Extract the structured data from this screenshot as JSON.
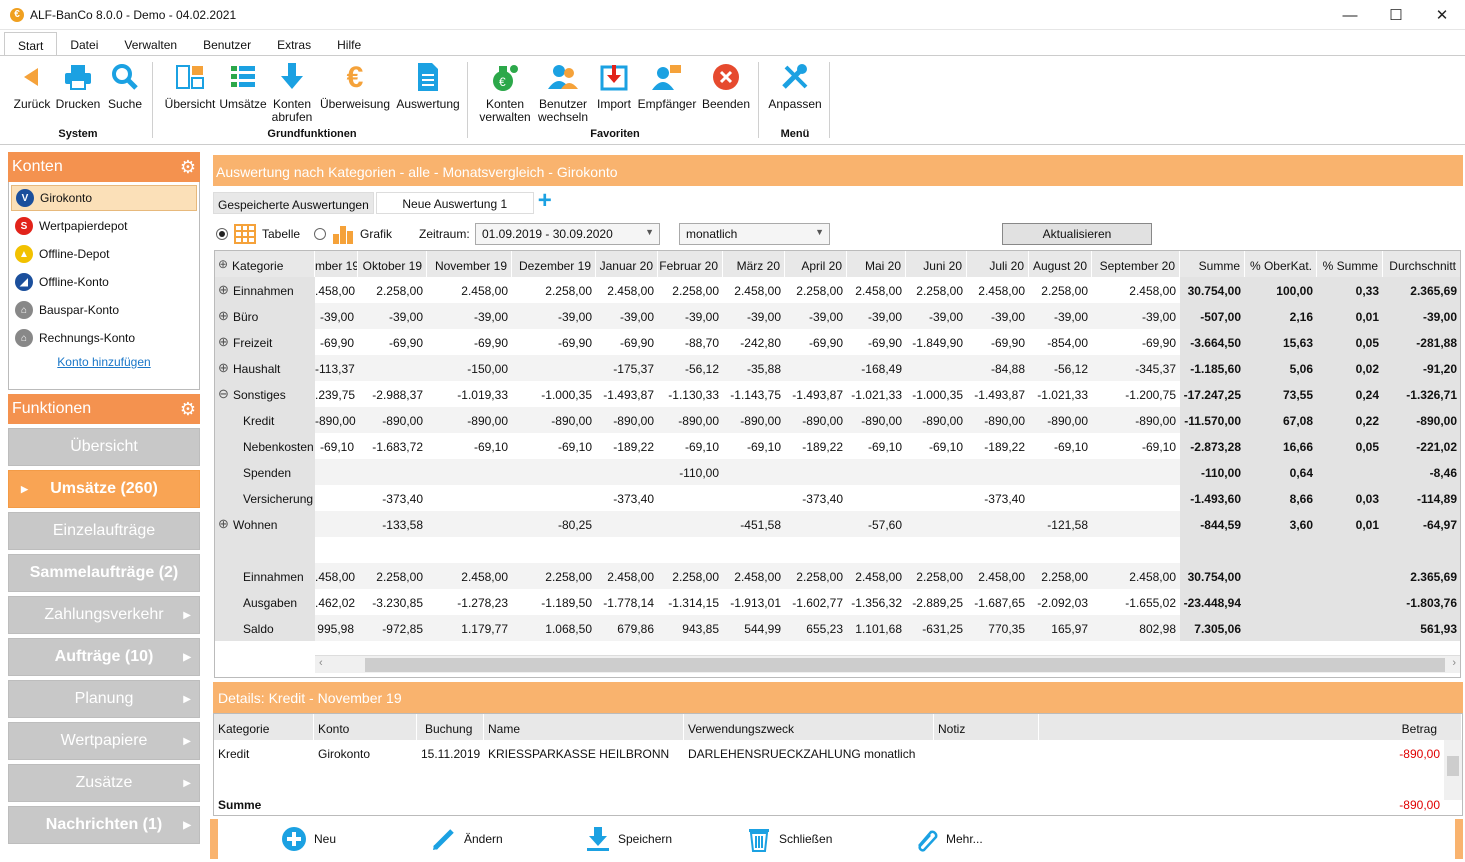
{
  "window": {
    "title": "ALF-BanCo 8.0.0 - Demo  -  04.02.2021"
  },
  "menu_tabs": [
    "Start",
    "Datei",
    "Verwalten",
    "Benutzer",
    "Extras",
    "Hilfe"
  ],
  "ribbon": {
    "buttons": [
      {
        "label": "Zurück",
        "icon": "back-arrow-icon"
      },
      {
        "label": "Drucken",
        "icon": "printer-icon"
      },
      {
        "label": "Suche",
        "icon": "search-icon"
      },
      {
        "label": "Übersicht",
        "icon": "overview-icon"
      },
      {
        "label": "Umsätze",
        "icon": "list-icon"
      },
      {
        "label": "Konten",
        "label2": "abrufen",
        "icon": "download-icon"
      },
      {
        "label": "Überweisung",
        "icon": "euro-icon"
      },
      {
        "label": "Auswertung",
        "icon": "document-icon"
      },
      {
        "label": "Konten",
        "label2": "verwalten",
        "icon": "money-bag-icon"
      },
      {
        "label": "Benutzer",
        "label2": "wechseln",
        "icon": "users-icon"
      },
      {
        "label": "Import",
        "icon": "import-icon"
      },
      {
        "label": "Empfänger",
        "icon": "recipient-icon"
      },
      {
        "label": "Beenden",
        "icon": "close-circle-icon"
      },
      {
        "label": "Anpassen",
        "icon": "tools-icon"
      }
    ],
    "groups": [
      "System",
      "Grundfunktionen",
      "Favoriten",
      "Menü"
    ]
  },
  "sidebar": {
    "konten_title": "Konten",
    "accounts": [
      {
        "name": "Girokonto",
        "selected": true,
        "color": "#1b4f9c"
      },
      {
        "name": "Wertpapierdepot",
        "color": "#e2231a"
      },
      {
        "name": "Offline-Depot",
        "color": "#f2c100"
      },
      {
        "name": "Offline-Konto",
        "color": "#1b4f9c"
      },
      {
        "name": "Bauspar-Konto",
        "color": "#888888"
      },
      {
        "name": "Rechnungs-Konto",
        "color": "#888888"
      }
    ],
    "add_account": "Konto hinzufügen",
    "funktionen_title": "Funktionen",
    "functions": [
      {
        "label": "Übersicht",
        "bold": false,
        "arrow": false
      },
      {
        "label": "Umsätze (260)",
        "bold": true,
        "arrow": false,
        "active": true
      },
      {
        "label": "Einzelaufträge",
        "bold": false,
        "arrow": false
      },
      {
        "label": "Sammelaufträge (2)",
        "bold": true,
        "arrow": false
      },
      {
        "label": "Zahlungsverkehr",
        "bold": false,
        "arrow": true
      },
      {
        "label": "Aufträge (10)",
        "bold": true,
        "arrow": true
      },
      {
        "label": "Planung",
        "bold": false,
        "arrow": true
      },
      {
        "label": "Wertpapiere",
        "bold": false,
        "arrow": true
      },
      {
        "label": "Zusätze",
        "bold": false,
        "arrow": true
      },
      {
        "label": "Nachrichten (1)",
        "bold": true,
        "arrow": true
      }
    ]
  },
  "report": {
    "title": "Auswertung nach Kategorien - alle - Monatsvergleich - Girokonto",
    "saved_tab": "Gespeicherte Auswertungen",
    "new_tab": "Neue Auswertung 1",
    "view_table": "Tabelle",
    "view_chart": "Grafik",
    "period_label": "Zeitraum:",
    "period_value": "01.09.2019 - 30.09.2020",
    "interval_value": "monatlich",
    "refresh": "Aktualisieren",
    "headers": [
      "Kategorie",
      "mber 19",
      "Oktober 19",
      "November 19",
      "Dezember 19",
      "Januar 20",
      "Februar 20",
      "März 20",
      "April 20",
      "Mai 20",
      "Juni 20",
      "Juli 20",
      "August 20",
      "September 20",
      "Summe",
      "% OberKat.",
      "% Summe",
      "Durchschnitt"
    ],
    "rows": [
      {
        "label": "Einnahmen",
        "expander": "plus",
        "indent": false,
        "values": [
          ".458,00",
          "2.258,00",
          "2.458,00",
          "2.258,00",
          "2.458,00",
          "2.258,00",
          "2.458,00",
          "2.258,00",
          "2.458,00",
          "2.258,00",
          "2.458,00",
          "2.258,00",
          "2.458,00",
          "30.754,00",
          "100,00",
          "0,33",
          "2.365,69"
        ]
      },
      {
        "label": "Büro",
        "expander": "plus",
        "indent": false,
        "values": [
          "-39,00",
          "-39,00",
          "-39,00",
          "-39,00",
          "-39,00",
          "-39,00",
          "-39,00",
          "-39,00",
          "-39,00",
          "-39,00",
          "-39,00",
          "-39,00",
          "-39,00",
          "-507,00",
          "2,16",
          "0,01",
          "-39,00"
        ]
      },
      {
        "label": "Freizeit",
        "expander": "plus",
        "indent": false,
        "values": [
          "-69,90",
          "-69,90",
          "-69,90",
          "-69,90",
          "-69,90",
          "-88,70",
          "-242,80",
          "-69,90",
          "-69,90",
          "-1.849,90",
          "-69,90",
          "-854,00",
          "-69,90",
          "-3.664,50",
          "15,63",
          "0,05",
          "-281,88"
        ]
      },
      {
        "label": "Haushalt",
        "expander": "plus",
        "indent": false,
        "values": [
          "-113,37",
          "",
          "-150,00",
          "",
          "-175,37",
          "-56,12",
          "-35,88",
          "",
          "-168,49",
          "",
          "-84,88",
          "-56,12",
          "-345,37",
          "-1.185,60",
          "5,06",
          "0,02",
          "-91,20"
        ]
      },
      {
        "label": "Sonstiges",
        "expander": "minus",
        "indent": false,
        "values": [
          ".239,75",
          "-2.988,37",
          "-1.019,33",
          "-1.000,35",
          "-1.493,87",
          "-1.130,33",
          "-1.143,75",
          "-1.493,87",
          "-1.021,33",
          "-1.000,35",
          "-1.493,87",
          "-1.021,33",
          "-1.200,75",
          "-17.247,25",
          "73,55",
          "0,24",
          "-1.326,71"
        ]
      },
      {
        "label": "Kredit",
        "expander": "",
        "indent": true,
        "values": [
          "-890,00",
          "-890,00",
          "-890,00",
          "-890,00",
          "-890,00",
          "-890,00",
          "-890,00",
          "-890,00",
          "-890,00",
          "-890,00",
          "-890,00",
          "-890,00",
          "-890,00",
          "-11.570,00",
          "67,08",
          "0,22",
          "-890,00"
        ],
        "highlight": 2
      },
      {
        "label": "Nebenkosten",
        "expander": "",
        "indent": true,
        "values": [
          "-69,10",
          "-1.683,72",
          "-69,10",
          "-69,10",
          "-189,22",
          "-69,10",
          "-69,10",
          "-189,22",
          "-69,10",
          "-69,10",
          "-189,22",
          "-69,10",
          "-69,10",
          "-2.873,28",
          "16,66",
          "0,05",
          "-221,02"
        ]
      },
      {
        "label": "Spenden",
        "expander": "",
        "indent": true,
        "values": [
          "",
          "",
          "",
          "",
          "",
          "-110,00",
          "",
          "",
          "",
          "",
          "",
          "",
          "",
          "-110,00",
          "0,64",
          "",
          "-8,46"
        ]
      },
      {
        "label": "Versicherung",
        "expander": "",
        "indent": true,
        "values": [
          "",
          "-373,40",
          "",
          "",
          "-373,40",
          "",
          "",
          "-373,40",
          "",
          "",
          "-373,40",
          "",
          "",
          "-1.493,60",
          "8,66",
          "0,03",
          "-114,89"
        ]
      },
      {
        "label": "Wohnen",
        "expander": "plus",
        "indent": false,
        "values": [
          "",
          "-133,58",
          "",
          "-80,25",
          "",
          "",
          "-451,58",
          "",
          "-57,60",
          "",
          "",
          "-121,58",
          "",
          "-844,59",
          "3,60",
          "0,01",
          "-64,97"
        ]
      },
      {
        "label": "",
        "expander": "",
        "indent": false,
        "values": [
          "",
          "",
          "",
          "",
          "",
          "",
          "",
          "",
          "",
          "",
          "",
          "",
          "",
          "",
          "",
          "",
          ""
        ]
      },
      {
        "label": "Einnahmen",
        "expander": "",
        "indent": true,
        "values": [
          ".458,00",
          "2.258,00",
          "2.458,00",
          "2.258,00",
          "2.458,00",
          "2.258,00",
          "2.458,00",
          "2.258,00",
          "2.458,00",
          "2.258,00",
          "2.458,00",
          "2.258,00",
          "2.458,00",
          "30.754,00",
          "",
          "",
          "2.365,69"
        ]
      },
      {
        "label": "Ausgaben",
        "expander": "",
        "indent": true,
        "values": [
          ".462,02",
          "-3.230,85",
          "-1.278,23",
          "-1.189,50",
          "-1.778,14",
          "-1.314,15",
          "-1.913,01",
          "-1.602,77",
          "-1.356,32",
          "-2.889,25",
          "-1.687,65",
          "-2.092,03",
          "-1.655,02",
          "-23.448,94",
          "",
          "",
          "-1.803,76"
        ]
      },
      {
        "label": "Saldo",
        "expander": "",
        "indent": true,
        "values": [
          "995,98",
          "-972,85",
          "1.179,77",
          "1.068,50",
          "679,86",
          "943,85",
          "544,99",
          "655,23",
          "1.101,68",
          "-631,25",
          "770,35",
          "165,97",
          "802,98",
          "7.305,06",
          "",
          "",
          "561,93"
        ]
      }
    ]
  },
  "details": {
    "title": "Details: Kredit - November 19",
    "headers": [
      "Kategorie",
      "Konto",
      "Buchung",
      "Name",
      "Verwendungszweck",
      "Notiz",
      "Betrag"
    ],
    "rows": [
      {
        "kategorie": "Kredit",
        "konto": "Girokonto",
        "buchung": "15.11.2019",
        "name": "KRIESSPARKASSE HEILBRONN",
        "zweck": "DARLEHENSRUECKZAHLUNG monatlich",
        "notiz": "",
        "betrag": "-890,00"
      }
    ],
    "sum_label": "Summe",
    "sum_value": "-890,00"
  },
  "footer": {
    "buttons": [
      {
        "label": "Neu",
        "icon": "plus-circle-icon"
      },
      {
        "label": "Ändern",
        "icon": "pencil-icon"
      },
      {
        "label": "Speichern",
        "icon": "save-icon"
      },
      {
        "label": "Schließen",
        "icon": "trash-icon"
      },
      {
        "label": "Mehr...",
        "icon": "paperclip-icon"
      }
    ]
  },
  "colors": {
    "accent": "#f4924f",
    "header_band": "#f9b36e",
    "negative": "#e00000",
    "blue": "#1ba1e2"
  }
}
